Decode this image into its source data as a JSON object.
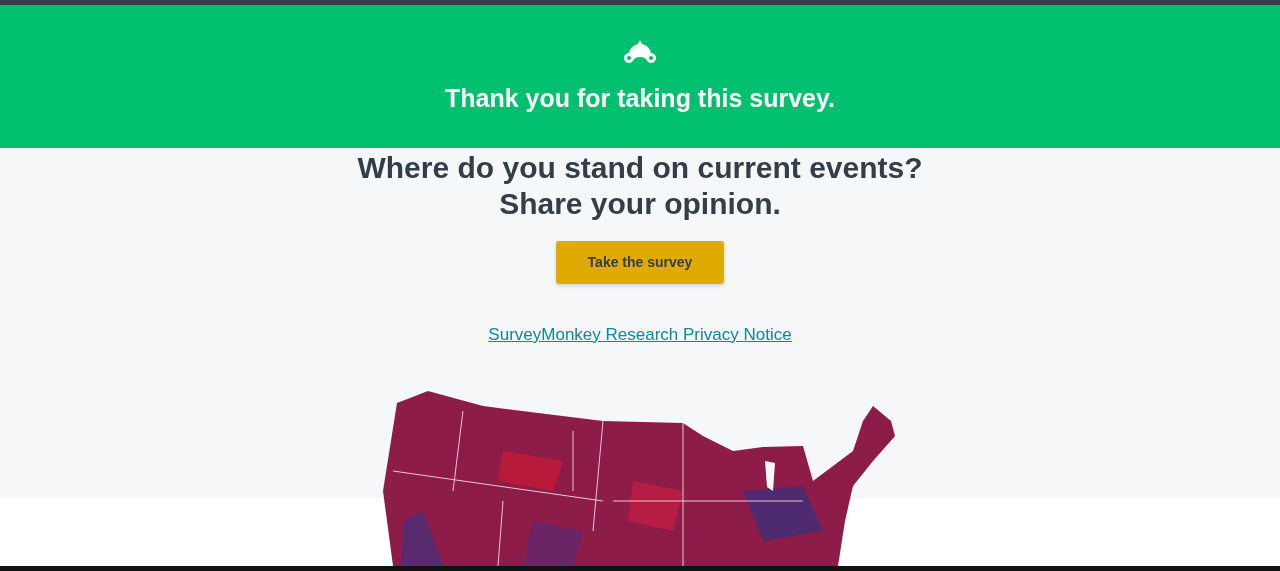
{
  "banner": {
    "title": "Thank you for taking this survey."
  },
  "headline": [
    "Where do you stand on current events?",
    "Share your opinion."
  ],
  "button": {
    "label": "Take the survey"
  },
  "privacy_link": {
    "label": "SurveyMonkey Research Privacy Notice"
  }
}
